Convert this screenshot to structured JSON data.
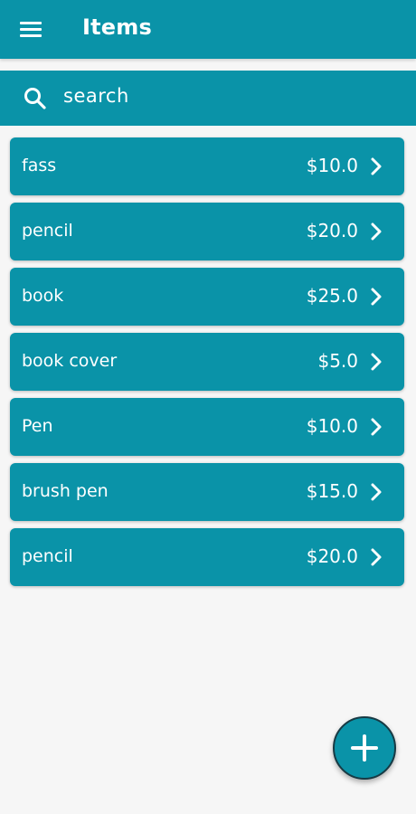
{
  "appbar": {
    "title": "Items"
  },
  "search": {
    "placeholder": "search"
  },
  "items": [
    {
      "name": "fass",
      "price": "$10.0"
    },
    {
      "name": "pencil",
      "price": "$20.0"
    },
    {
      "name": "book",
      "price": "$25.0"
    },
    {
      "name": "book cover",
      "price": "$5.0"
    },
    {
      "name": "Pen",
      "price": "$10.0"
    },
    {
      "name": "brush pen",
      "price": "$15.0"
    },
    {
      "name": "pencil",
      "price": "$20.0"
    }
  ],
  "icons": {
    "menu": "menu-icon",
    "search": "search-icon",
    "chevron": "chevron-right-icon",
    "add": "plus-icon"
  },
  "colors": {
    "primary": "#0a93a8",
    "background": "#f6f6f6",
    "text": "#ffffff",
    "fab_border": "#173a44"
  }
}
